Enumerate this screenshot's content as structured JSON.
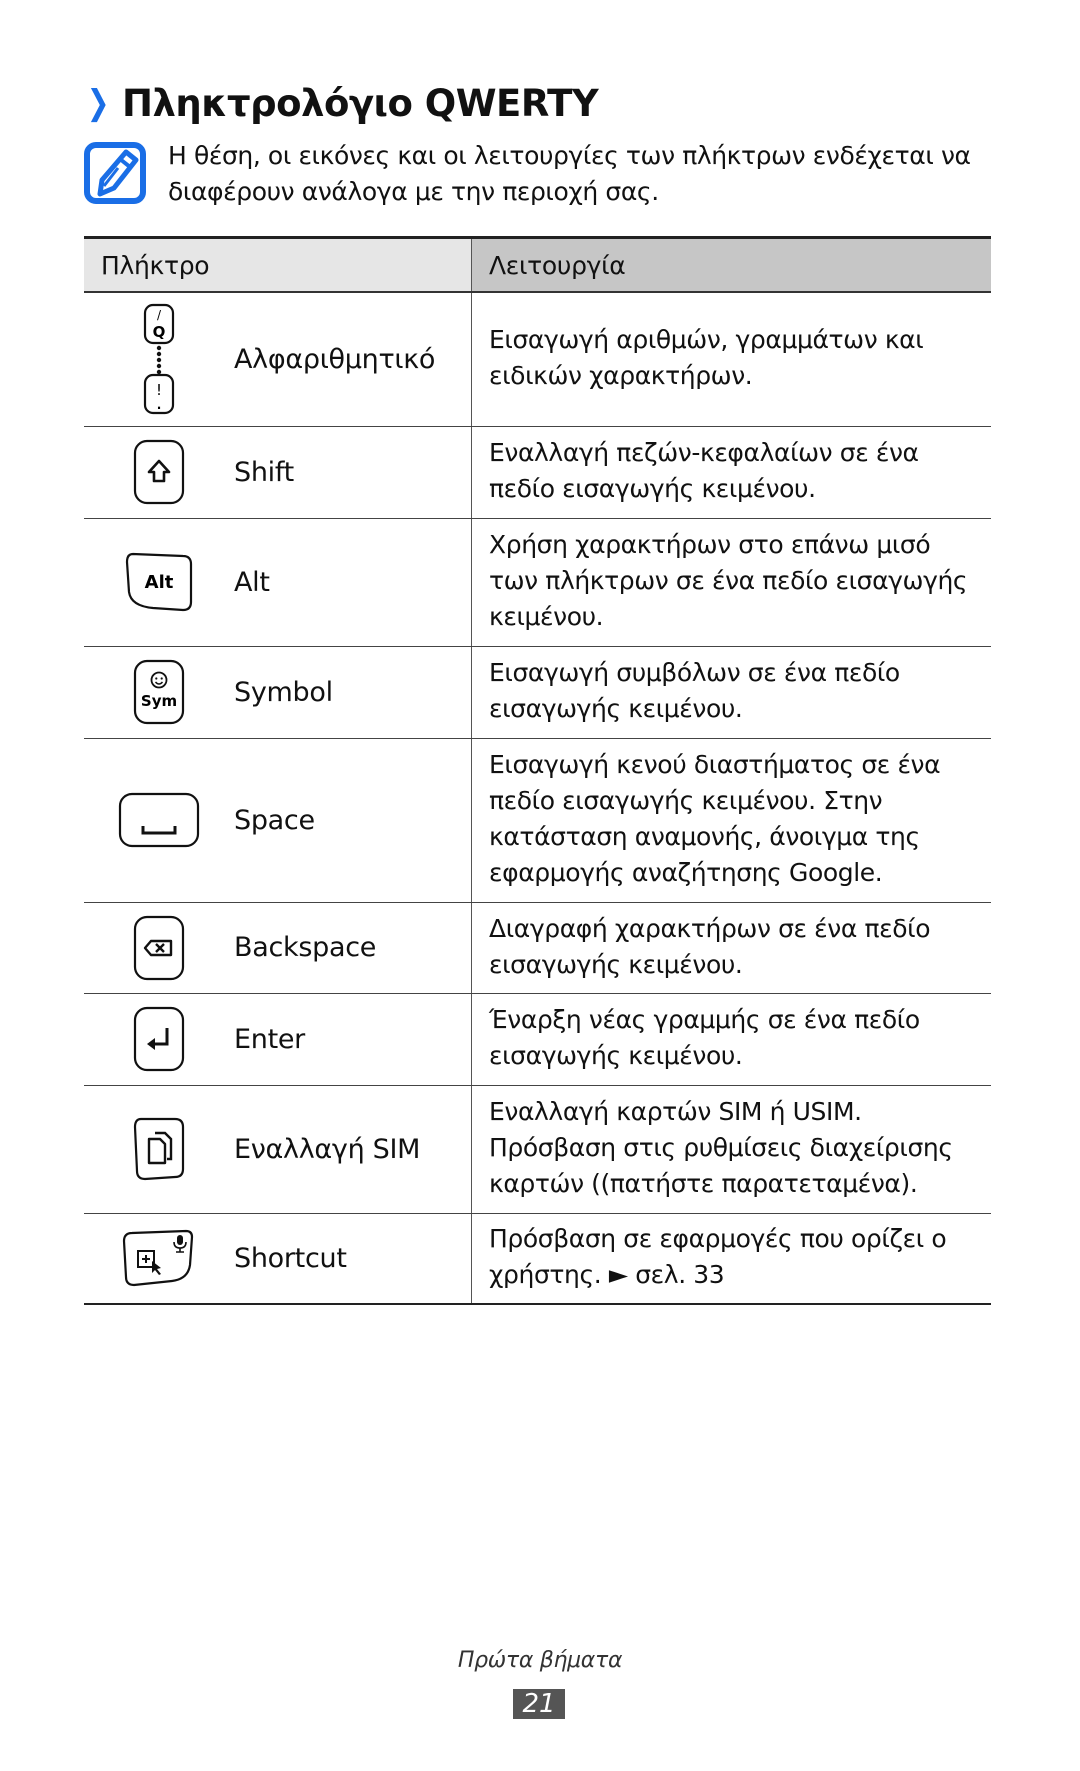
{
  "page": {
    "title": "Πληκτρολόγιο QWERTY",
    "title_icon": "chevron-right-icon",
    "accent_color": "#1a6ee6",
    "note": {
      "icon": "note-pencil-icon",
      "text": "Η θέση, οι εικόνες και οι λειτουργίες των πλήκτρων ενδέχεται να διαφέρουν ανάλογα με την περιοχή σας."
    }
  },
  "table": {
    "headers": {
      "key": "Πλήκτρο",
      "function": "Λειτουργία"
    },
    "rows": [
      {
        "icon": "alphanumeric-key-icon",
        "key": "Αλφαριθμητικό",
        "function": "Εισαγωγή αριθμών, γραμμάτων και ειδικών χαρακτήρων."
      },
      {
        "icon": "shift-key-icon",
        "key": "Shift",
        "function": "Εναλλαγή πεζών-κεφαλαίων σε ένα πεδίο εισαγωγής κειμένου."
      },
      {
        "icon": "alt-key-icon",
        "key": "Alt",
        "function": "Χρήση χαρακτήρων στο επάνω μισό των πλήκτρων σε ένα πεδίο εισαγωγής κειμένου."
      },
      {
        "icon": "symbol-key-icon",
        "key": "Symbol",
        "function": "Εισαγωγή συμβόλων σε ένα πεδίο εισαγωγής κειμένου."
      },
      {
        "icon": "space-key-icon",
        "key": "Space",
        "function": "Εισαγωγή κενού διαστήματος σε ένα πεδίο εισαγωγής κειμένου. Στην κατάσταση αναμονής, άνοιγμα της εφαρμογής αναζήτησης Google."
      },
      {
        "icon": "backspace-key-icon",
        "key": "Backspace",
        "function": "Διαγραφή χαρακτήρων σε ένα πεδίο εισαγωγής κειμένου."
      },
      {
        "icon": "enter-key-icon",
        "key": "Enter",
        "function": "Έναρξη νέας γραμμής σε ένα πεδίο εισαγωγής κειμένου."
      },
      {
        "icon": "sim-switch-key-icon",
        "key": "Εναλλαγή SIM",
        "function": "Εναλλαγή καρτών SIM ή USIM. Πρόσβαση στις ρυθμίσεις διαχείρισης καρτών ((πατήστε παρατεταμένα)."
      },
      {
        "icon": "shortcut-key-icon",
        "key": "Shortcut",
        "function": "Πρόσβαση σε εφαρμογές που ορίζει ο χρήστης. ► σελ. 33"
      }
    ],
    "alt_key_glyph": "Alt",
    "sym_key_glyph": "Sym",
    "alpha_key_top": "Q",
    "alpha_key_top_sub": "/",
    "alpha_key_bottom": "!",
    "alpha_key_bottom_sub": "."
  },
  "footer": {
    "section": "Πρώτα βήματα",
    "page_number": "21"
  }
}
